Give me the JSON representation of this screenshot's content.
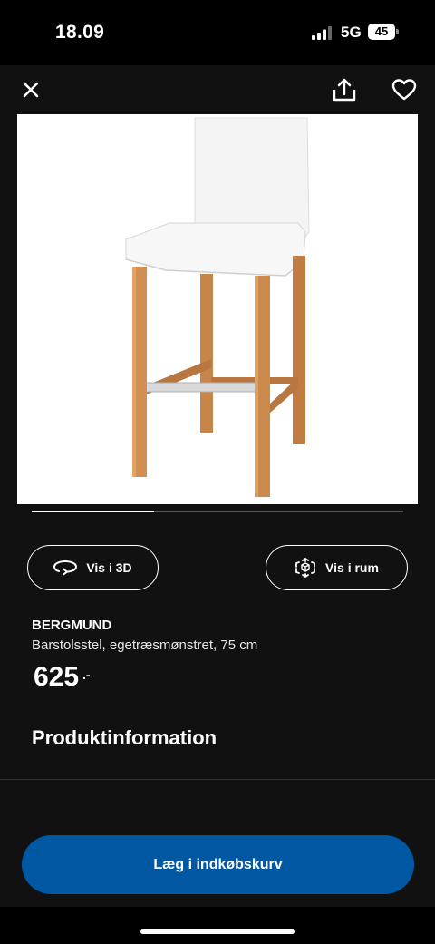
{
  "status": {
    "time": "18.09",
    "network": "5G",
    "battery": "45"
  },
  "header": {
    "close_icon": "close-icon",
    "share_icon": "share-icon",
    "favorite_icon": "heart-icon"
  },
  "gallery": {
    "progress_fraction": 0.33
  },
  "actions": {
    "view_3d_label": "Vis i 3D",
    "view_room_label": "Vis i rum"
  },
  "product": {
    "name": "BERGMUND",
    "description": "Barstolsstel, egetræsmønstret, 75 cm",
    "price": "625",
    "price_suffix": ".-"
  },
  "section": {
    "title": "Produktinformation"
  },
  "cart": {
    "button_label": "Læg i indkøbskurv"
  },
  "colors": {
    "accent": "#0058a3",
    "background": "#111111"
  }
}
